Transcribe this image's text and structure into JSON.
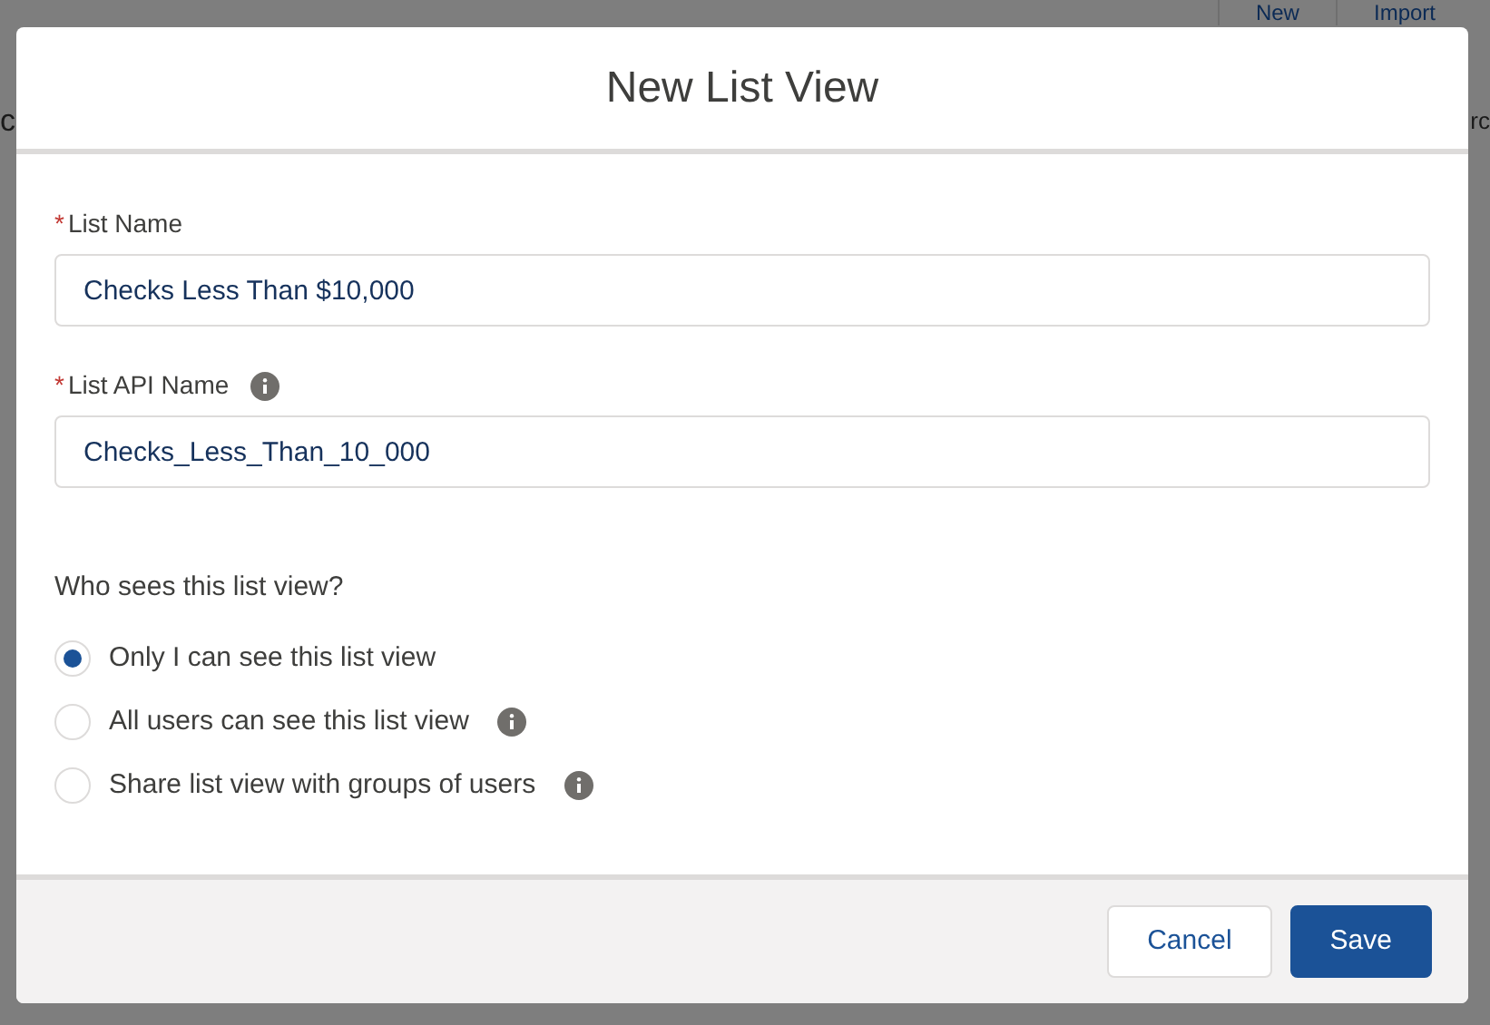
{
  "background": {
    "buttons": [
      "New",
      "Import"
    ],
    "left_fragment": "c",
    "right_fragment": "rc"
  },
  "modal": {
    "title": "New List View",
    "fields": [
      {
        "marker": "*",
        "label": "List Name",
        "info": false,
        "value": "Checks Less Than $10,000"
      },
      {
        "marker": "*",
        "label": "List API Name",
        "info": true,
        "value": "Checks_Less_Than_10_000"
      }
    ],
    "visibility": {
      "question": "Who sees this list view?",
      "options": [
        {
          "label": "Only I can see this list view",
          "selected": true,
          "info": false
        },
        {
          "label": "All users can see this list view",
          "selected": false,
          "info": true
        },
        {
          "label": "Share list view with groups of users",
          "selected": false,
          "info": true
        }
      ]
    },
    "buttons": [
      {
        "label": "Cancel",
        "kind": "neutral"
      },
      {
        "label": "Save",
        "kind": "brand"
      }
    ]
  }
}
